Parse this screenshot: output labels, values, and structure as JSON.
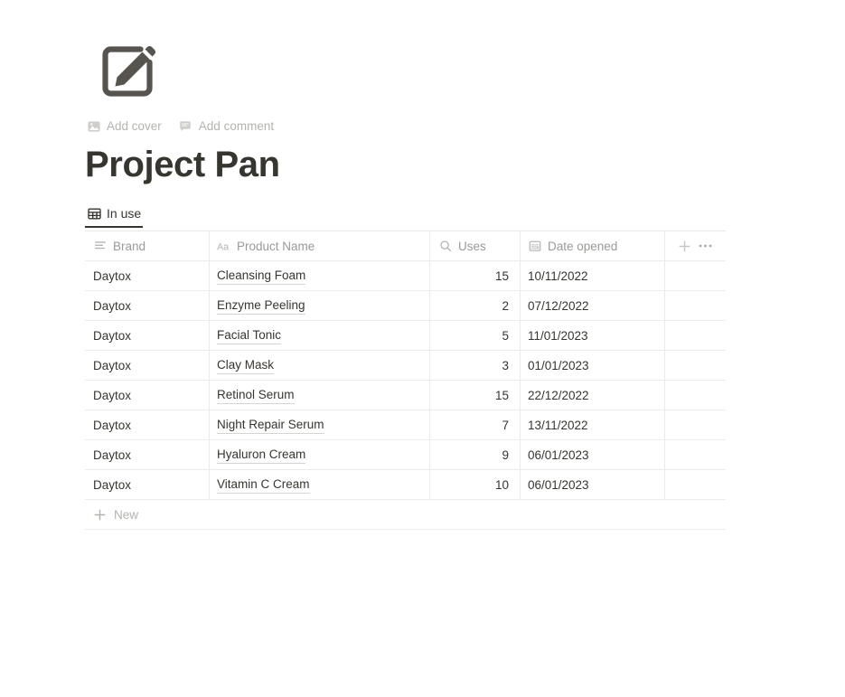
{
  "page": {
    "icon": "memo-pencil-icon",
    "title": "Project Pan"
  },
  "meta_actions": [
    {
      "icon": "image-icon",
      "label": "Add cover"
    },
    {
      "icon": "comment-icon",
      "label": "Add comment"
    }
  ],
  "views": [
    {
      "icon": "table-grid-icon",
      "label": "In use",
      "active": true
    }
  ],
  "table": {
    "columns": [
      {
        "key": "brand",
        "label": "Brand",
        "icon": "text-lines-icon",
        "align": "left"
      },
      {
        "key": "name",
        "label": "Product Name",
        "icon": "aa-title-icon",
        "align": "left"
      },
      {
        "key": "uses",
        "label": "Uses",
        "icon": "magnifier-icon",
        "align": "right"
      },
      {
        "key": "date",
        "label": "Date opened",
        "icon": "calendar-icon",
        "align": "left"
      }
    ],
    "header_actions": [
      {
        "icon": "plus-icon",
        "label": "+"
      },
      {
        "icon": "ellipsis-icon",
        "label": "•••"
      }
    ],
    "rows": [
      {
        "brand": "Daytox",
        "name": "Cleansing Foam",
        "uses": "15",
        "date": "10/11/2022"
      },
      {
        "brand": "Daytox",
        "name": "Enzyme Peeling",
        "uses": "2",
        "date": "07/12/2022"
      },
      {
        "brand": "Daytox",
        "name": "Facial Tonic",
        "uses": "5",
        "date": "11/01/2023"
      },
      {
        "brand": "Daytox",
        "name": "Clay Mask",
        "uses": "3",
        "date": "01/01/2023"
      },
      {
        "brand": "Daytox",
        "name": "Retinol Serum",
        "uses": "15",
        "date": "22/12/2022"
      },
      {
        "brand": "Daytox",
        "name": "Night Repair Serum",
        "uses": "7",
        "date": "13/11/2022"
      },
      {
        "brand": "Daytox",
        "name": "Hyaluron Cream",
        "uses": "9",
        "date": "06/01/2023"
      },
      {
        "brand": "Daytox",
        "name": "Vitamin C Cream",
        "uses": "10",
        "date": "06/01/2023"
      }
    ],
    "new_row": {
      "icon": "plus-icon",
      "label": "New"
    }
  },
  "colors": {
    "text": "#37352f",
    "muted": "#9b9a97",
    "placeholder": "#b5b3ae",
    "border": "#ebebea",
    "icon": "#575450"
  }
}
